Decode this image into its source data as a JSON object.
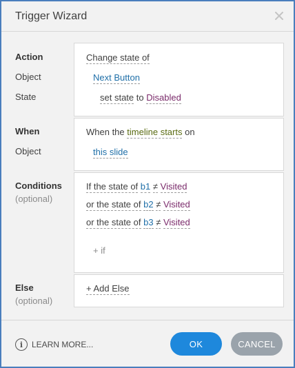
{
  "titlebar": {
    "title": "Trigger Wizard",
    "close_glyph": "✕",
    "close_icon": "close-icon"
  },
  "action": {
    "label_action": "Action",
    "label_object": "Object",
    "label_state": "State",
    "action_value": "Change state of",
    "object_value": "Next Button",
    "set_word": "set state",
    "to_word": "to",
    "state_value": "Disabled"
  },
  "when": {
    "label_when": "When",
    "label_object": "Object",
    "prefix": "When the",
    "event": "timeline starts",
    "suffix": "on",
    "object_value": "this slide"
  },
  "conditions": {
    "label": "Conditions",
    "optional": "(optional)",
    "rows": [
      {
        "lead": "If the state of",
        "object": "b1",
        "op": "≠",
        "value": "Visited"
      },
      {
        "lead": "or the state of",
        "object": "b2",
        "op": "≠",
        "value": "Visited"
      },
      {
        "lead": "or the state of",
        "object": "b3",
        "op": "≠",
        "value": "Visited"
      }
    ],
    "add_if": "+ if"
  },
  "else": {
    "label": "Else",
    "optional": "(optional)",
    "add_else": "+ Add Else"
  },
  "footer": {
    "learn_more": "LEARN MORE...",
    "info_glyph": "i",
    "info_icon": "info-icon",
    "ok": "OK",
    "cancel": "CANCEL"
  },
  "colors": {
    "accent": "#1e88dc",
    "border": "#4a7ebd",
    "link_blue": "#1f6fa8",
    "event_green": "#5a6b12",
    "value_purple": "#7a2a6a",
    "cancel_gray": "#9aa3ab"
  }
}
